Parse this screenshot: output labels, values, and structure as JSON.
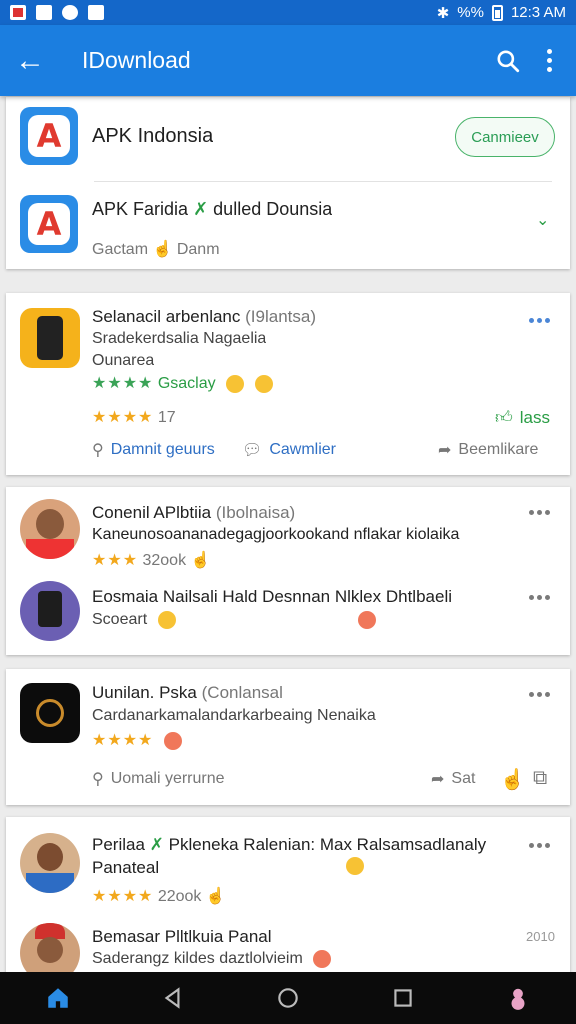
{
  "status_bar": {
    "time": "12:3 AM",
    "signal": "%%"
  },
  "app_bar": {
    "title": "IDownload"
  },
  "card1": {
    "row1": {
      "name": "APK Indonsia",
      "button": "Canmieev"
    },
    "row2": {
      "name": "APK Faridia",
      "name_rest": "dulled Dounsia",
      "meta1": "Gactam",
      "meta2": "Danm"
    }
  },
  "post1": {
    "title": "Selanacil arbenlanc",
    "title_tag": "(I9lantsa)",
    "line1": "Sradekerdsalia Nagaelia",
    "line2": "Ounarea",
    "rating_label": "Gsaclay",
    "stars": "★★★★",
    "count": "17",
    "like_label": "lass",
    "action1": "Damnit geuurs",
    "action2": "Cawmlier",
    "action3": "Beemlikare"
  },
  "post2": {
    "c1_title": "Conenil APlbtiia",
    "c1_tag": "(Ibolnaisa)",
    "c1_text": "Kaneunosoananadegagjoorkookand nflakar kiolaika",
    "c1_count": "32ook",
    "c2_title": "Eosmaia Nailsali Hald Desnnan Nlklex Dhtlbaeli",
    "c2_text": "Scoeart"
  },
  "post3": {
    "title": "Uunilan. Pska",
    "title_tag": "(Conlansal",
    "line1": "Cardanarkamalandarkarbeaing Nenaika",
    "stars": "★★★★",
    "action1": "Uomali yerrurne",
    "action2": "Sat"
  },
  "post4": {
    "c1_title": "Perilaa",
    "c1_title_rest": "Pkleneka Ralenian: Max Ralsamsadlanaly",
    "c1_line2": "Panateal",
    "c1_count": "22ook",
    "c2_title": "Bemasar Plltlkuia Panal",
    "c2_text": "Saderangz kildes daztlolvieim",
    "c2_time": "2010"
  },
  "colors": {
    "primary": "#1b7ee0",
    "status": "#1467c9",
    "green": "#2a9d45",
    "star": "#f2a81d"
  }
}
